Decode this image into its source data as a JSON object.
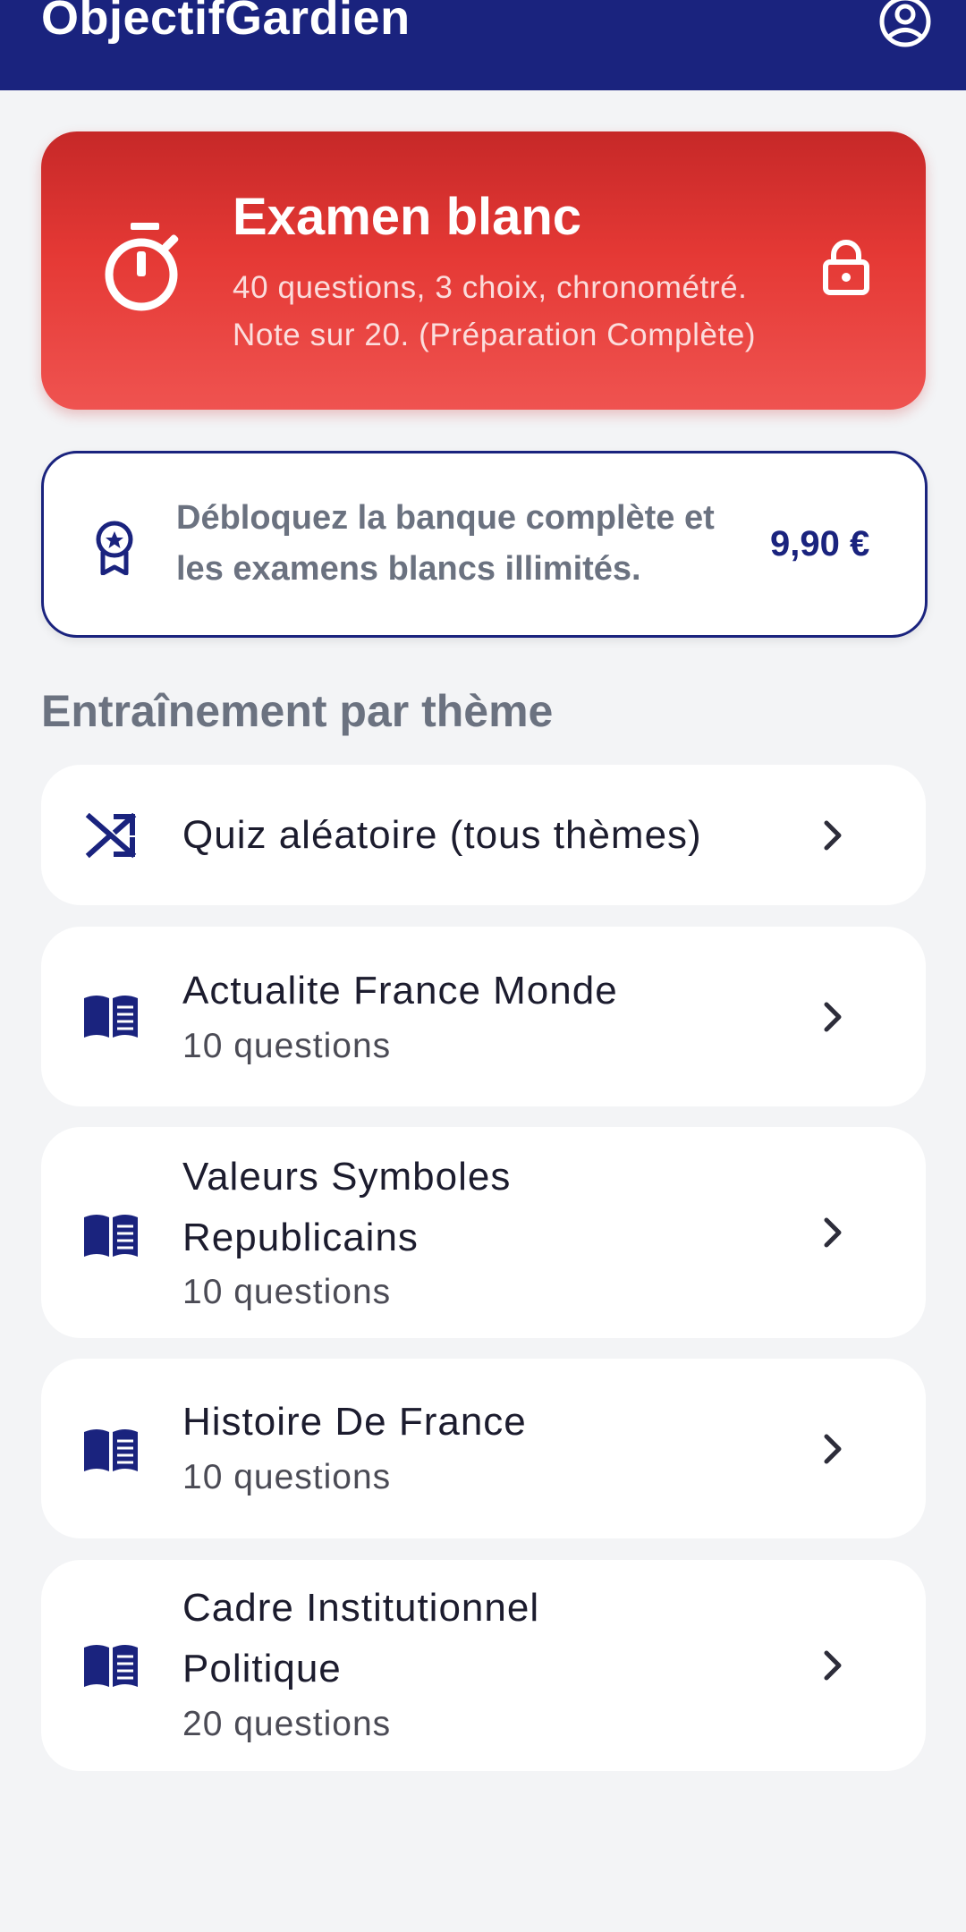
{
  "app": {
    "title": "ObjectifGardien",
    "brand_color": "#1a237e",
    "account_icon": "account-circle-icon"
  },
  "exam": {
    "title": "Examen blanc",
    "desc_line1": "40 questions, 3 choix, chronométré.",
    "desc_line2": "Note sur 20. (Préparation Complète)",
    "icon": "timer-icon",
    "locked": true,
    "colors": [
      "#c62828",
      "#ef5350"
    ]
  },
  "promo": {
    "line1": "Débloquez la banque complète et",
    "line2": "les examens blancs illimités.",
    "price": "9,90 €",
    "icon": "medal-icon"
  },
  "section": {
    "title": "Entraînement par thème"
  },
  "themes": [
    {
      "icon": "shuffle-icon",
      "title_lines": [
        "Quiz aléatoire (tous thèmes)"
      ],
      "subtitle": ""
    },
    {
      "icon": "book-icon",
      "title_lines": [
        "Actualite France Monde"
      ],
      "subtitle": "10 questions"
    },
    {
      "icon": "book-icon",
      "title_lines": [
        "Valeurs Symboles",
        "Republicains"
      ],
      "subtitle": "10 questions"
    },
    {
      "icon": "book-icon",
      "title_lines": [
        "Histoire De France"
      ],
      "subtitle": "10 questions"
    },
    {
      "icon": "book-icon",
      "title_lines": [
        "Cadre Institutionnel",
        "Politique"
      ],
      "subtitle": "20 questions"
    }
  ]
}
